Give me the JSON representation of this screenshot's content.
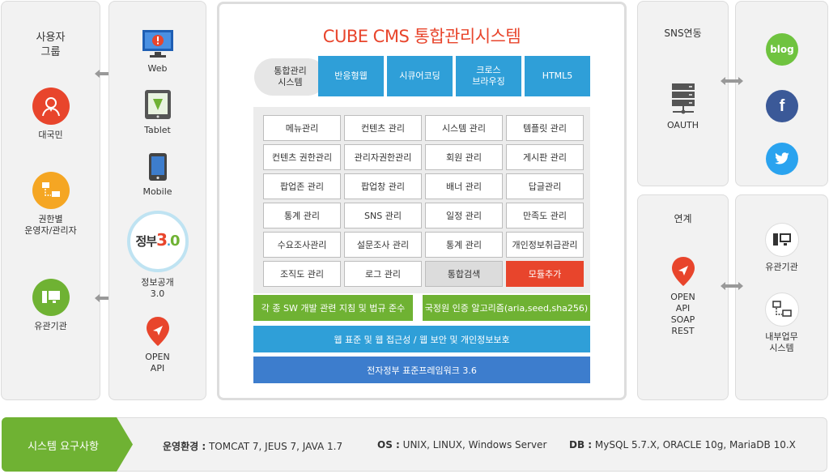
{
  "left": {
    "title": "사용자\n그룹",
    "items": [
      {
        "label": "대국민",
        "icon": "citizen-icon",
        "color": "#e8452c"
      },
      {
        "label": "권한별\n운영자/관리자",
        "icon": "admin-network-icon",
        "color": "#f5a623"
      },
      {
        "label": "유관기관",
        "icon": "organization-icon",
        "color": "#6fb233"
      }
    ]
  },
  "devices": {
    "items": [
      {
        "label": "Web",
        "icon": "monitor-icon"
      },
      {
        "label": "Tablet",
        "icon": "tablet-icon"
      },
      {
        "label": "Mobile",
        "icon": "mobile-icon"
      },
      {
        "label": "정보공개\n3.0",
        "icon": "gov30-logo",
        "logo_text": "정부3.0"
      },
      {
        "label": "OPEN\nAPI",
        "icon": "location-pin-icon"
      }
    ]
  },
  "main": {
    "title": "CUBE CMS 통합관리시스템",
    "pill": "통합관리\n시스템",
    "tabs": [
      "반응형웹",
      "시큐어코딩",
      "크로스\n브라우징",
      "HTML5"
    ],
    "modules": [
      [
        "메뉴관리",
        "컨텐츠 관리",
        "시스템 관리",
        "템플릿 관리"
      ],
      [
        "컨텐츠 권한관리",
        "관리자권한관리",
        "회원 관리",
        "게시판 관리"
      ],
      [
        "팝업존 관리",
        "팝업창 관리",
        "배너 관리",
        "답글관리"
      ],
      [
        "통계 관리",
        "SNS 관리",
        "일정 관리",
        "만족도 관리"
      ],
      [
        "수요조사관리",
        "설문조사 관리",
        "통계 관리",
        "개인정보취급관리"
      ],
      [
        "조직도 관리",
        "로그 관리",
        "통합검색",
        "모듈추가"
      ]
    ],
    "bar_left": "각 종 SW 개발 관련 지침 및 법규 준수",
    "bar_right": "국정원 인증 알고리즘(aria,seed,sha256)",
    "bar_wide": "웹 표준 및 웹 접근성 / 웹 보안 및 개인정보보호",
    "bar_base": "전자정부 표준프레임워크 3.6"
  },
  "sns": {
    "title": "SNS연동",
    "oauth": "OAUTH",
    "icons": [
      {
        "name": "blog-icon",
        "text": "blog",
        "color": "#6fc33f"
      },
      {
        "name": "facebook-icon",
        "text": "f",
        "color": "#3b5998"
      },
      {
        "name": "twitter-icon",
        "text": "",
        "color": "#2aa3ef"
      }
    ]
  },
  "link": {
    "title": "연계",
    "api": "OPEN\nAPI\nSOAP\nREST",
    "targets": [
      "유관기관",
      "내부업무\n시스템"
    ]
  },
  "footer": {
    "label": "시스템 요구사항",
    "env_key": "운영환경 :",
    "env_val": "TOMCAT 7, JEUS 7, JAVA 1.7",
    "os_key": "OS :",
    "os_val": "UNIX, LINUX, Windows Server",
    "db_key": "DB :",
    "db_val": "MySQL 5.7.X, ORACLE 10g, MariaDB 10.X"
  },
  "colors": {
    "accent_red": "#e8452c",
    "blue": "#2f9fd8",
    "green": "#6fb233",
    "dark_blue": "#3d7dcd"
  }
}
